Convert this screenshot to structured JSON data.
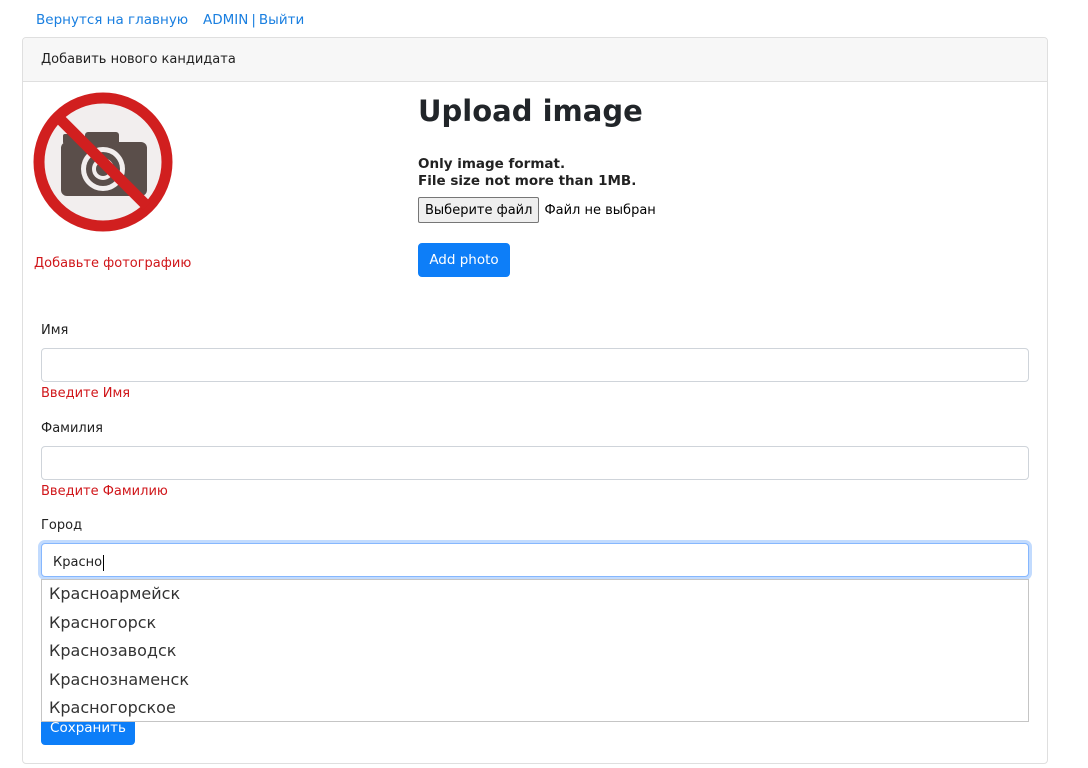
{
  "nav": {
    "home_link": "Вернутся на главную",
    "user_link": "ADMIN",
    "separator": "|",
    "logout_link": "Выйти"
  },
  "card": {
    "header": "Добавить нового кандидата"
  },
  "photo": {
    "icon": "no-camera-icon",
    "hint": "Добавьте фотографию"
  },
  "upload": {
    "title": "Upload image",
    "format_note": "Only image format.",
    "size_note": "File size not more than 1MB.",
    "choose_file_label": "Выберите файл",
    "file_status": "Файл не выбран",
    "add_photo_label": "Add photo"
  },
  "form": {
    "first_name": {
      "label": "Имя",
      "value": "",
      "error": "Введите Имя"
    },
    "last_name": {
      "label": "Фамилия",
      "value": "",
      "error": "Введите Фамилию"
    },
    "city": {
      "label": "Город",
      "value": "Красно",
      "suggestions": [
        "Красноармейск",
        "Красногорск",
        "Краснозаводск",
        "Краснознаменск",
        "Красногорское"
      ]
    },
    "save_label": "Сохранить"
  },
  "colors": {
    "link": "#1a7fe0",
    "primary": "#0d7ef8",
    "error": "#d0161a",
    "no_sign_red": "#d11f1f",
    "camera_dark": "#5a4e4a"
  }
}
